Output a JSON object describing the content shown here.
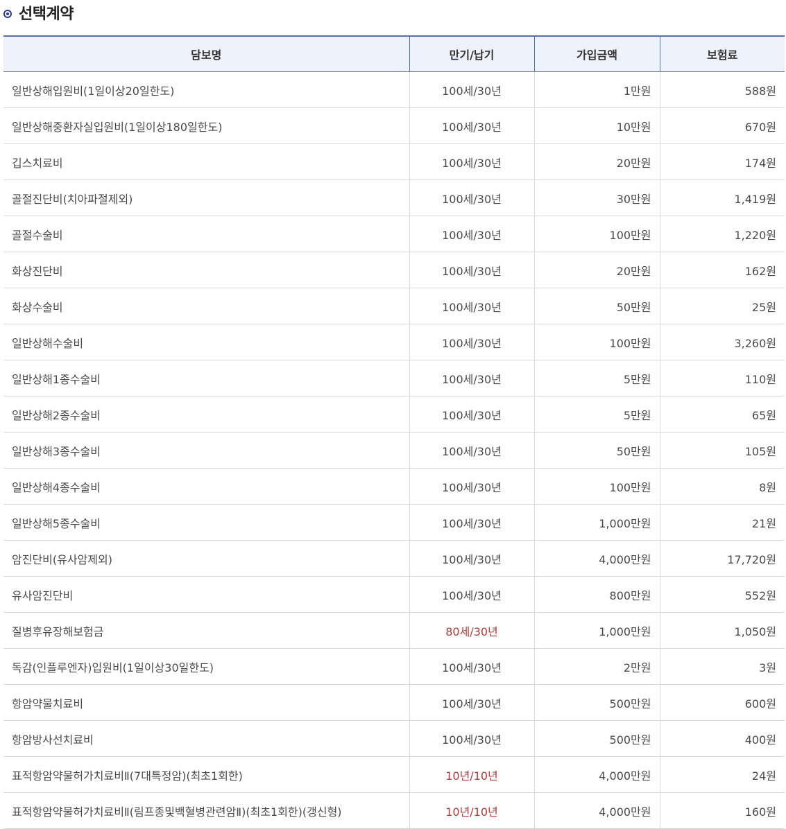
{
  "section": {
    "title": "선택계약"
  },
  "table": {
    "headers": [
      "담보명",
      "만기/납기",
      "가입금액",
      "보험료"
    ],
    "rows": [
      {
        "name": "일반상해입원비(1일이상20일한도)",
        "term": "100세/30년",
        "amount": "1만원",
        "premium": "588원"
      },
      {
        "name": "일반상해중환자실입원비(1일이상180일한도)",
        "term": "100세/30년",
        "amount": "10만원",
        "premium": "670원"
      },
      {
        "name": "깁스치료비",
        "term": "100세/30년",
        "amount": "20만원",
        "premium": "174원"
      },
      {
        "name": "골절진단비(치아파절제외)",
        "term": "100세/30년",
        "amount": "30만원",
        "premium": "1,419원"
      },
      {
        "name": "골절수술비",
        "term": "100세/30년",
        "amount": "100만원",
        "premium": "1,220원"
      },
      {
        "name": "화상진단비",
        "term": "100세/30년",
        "amount": "20만원",
        "premium": "162원"
      },
      {
        "name": "화상수술비",
        "term": "100세/30년",
        "amount": "50만원",
        "premium": "25원"
      },
      {
        "name": "일반상해수술비",
        "term": "100세/30년",
        "amount": "100만원",
        "premium": "3,260원"
      },
      {
        "name": "일반상해1종수술비",
        "term": "100세/30년",
        "amount": "5만원",
        "premium": "110원"
      },
      {
        "name": "일반상해2종수술비",
        "term": "100세/30년",
        "amount": "5만원",
        "premium": "65원"
      },
      {
        "name": "일반상해3종수술비",
        "term": "100세/30년",
        "amount": "50만원",
        "premium": "105원"
      },
      {
        "name": "일반상해4종수술비",
        "term": "100세/30년",
        "amount": "100만원",
        "premium": "8원"
      },
      {
        "name": "일반상해5종수술비",
        "term": "100세/30년",
        "amount": "1,000만원",
        "premium": "21원"
      },
      {
        "name": "암진단비(유사암제외)",
        "term": "100세/30년",
        "amount": "4,000만원",
        "premium": "17,720원"
      },
      {
        "name": "유사암진단비",
        "term": "100세/30년",
        "amount": "800만원",
        "premium": "552원"
      },
      {
        "name": "질병후유장해보험금",
        "term": "80세/30년",
        "amount": "1,000만원",
        "premium": "1,050원"
      },
      {
        "name": "독감(인플루엔자)입원비(1일이상30일한도)",
        "term": "100세/30년",
        "amount": "2만원",
        "premium": "3원"
      },
      {
        "name": "항암약물치료비",
        "term": "100세/30년",
        "amount": "500만원",
        "premium": "600원"
      },
      {
        "name": "항암방사선치료비",
        "term": "100세/30년",
        "amount": "500만원",
        "premium": "400원"
      },
      {
        "name": "표적항암약물허가치료비Ⅱ(7대특정암)(최초1회한)",
        "term": "10년/10년",
        "amount": "4,000만원",
        "premium": "24원"
      },
      {
        "name": "표적항암약물허가치료비Ⅱ(림프종및백혈병관련암Ⅱ)(최초1회한)(갱신형)",
        "term": "10년/10년",
        "amount": "4,000만원",
        "premium": "160원"
      }
    ]
  },
  "colors": {
    "accent": "#2e3d8f",
    "header_bg": "#eef3fb",
    "header_border": "#5870aa",
    "row_border": "#d8d8d8",
    "highlight_term": "#b23a3a"
  }
}
